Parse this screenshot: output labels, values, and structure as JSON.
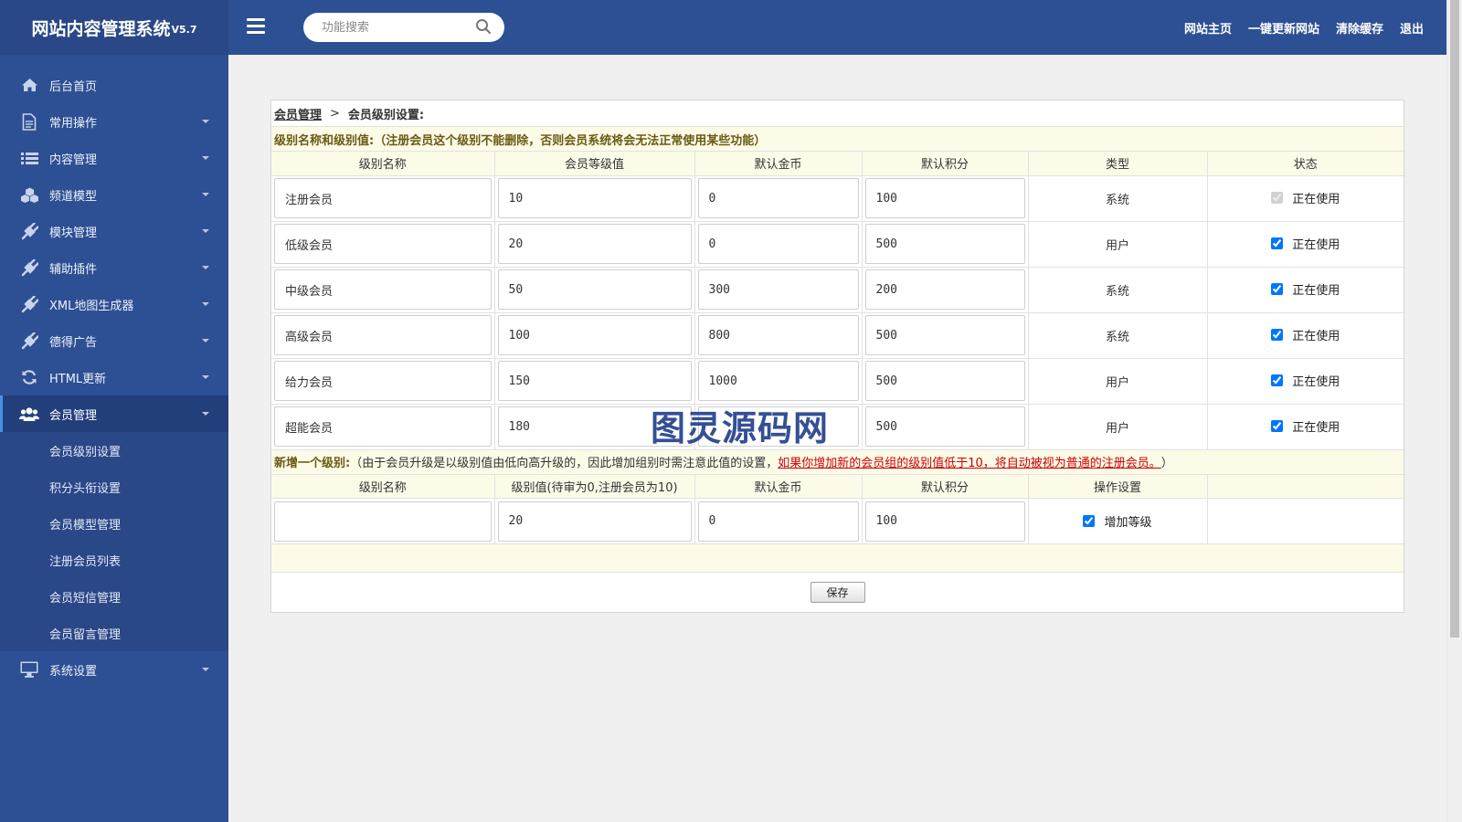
{
  "app": {
    "name": "网站内容管理系统",
    "version": "V5.7"
  },
  "search": {
    "placeholder": "功能搜索",
    "icon": "search-icon"
  },
  "topnav": [
    {
      "label": "网站主页"
    },
    {
      "label": "一键更新网站"
    },
    {
      "label": "清除缓存"
    },
    {
      "label": "退出"
    }
  ],
  "sidebar": {
    "items": [
      {
        "label": "后台首页",
        "icon": "home-icon"
      },
      {
        "label": "常用操作",
        "icon": "document-icon"
      },
      {
        "label": "内容管理",
        "icon": "list-icon"
      },
      {
        "label": "频道模型",
        "icon": "cubes-icon"
      },
      {
        "label": "模块管理",
        "icon": "plug-icon"
      },
      {
        "label": "辅助插件",
        "icon": "plug-icon"
      },
      {
        "label": "XML地图生成器",
        "icon": "plug-icon"
      },
      {
        "label": "德得广告",
        "icon": "plug-icon"
      },
      {
        "label": "HTML更新",
        "icon": "refresh-icon"
      },
      {
        "label": "会员管理",
        "icon": "users-icon"
      },
      {
        "label": "系统设置",
        "icon": "desktop-icon"
      }
    ],
    "submenu": [
      {
        "label": "会员级别设置"
      },
      {
        "label": "积分头衔设置"
      },
      {
        "label": "会员模型管理"
      },
      {
        "label": "注册会员列表"
      },
      {
        "label": "会员短信管理"
      },
      {
        "label": "会员留言管理"
      }
    ]
  },
  "breadcrumb": {
    "parent": "会员管理",
    "separator": ">",
    "current": "会员级别设置:"
  },
  "notice": "级别名称和级别值:（注册会员这个级别不能删除，否则会员系统将会无法正常使用某些功能）",
  "levels_table": {
    "headers": [
      "级别名称",
      "会员等级值",
      "默认金币",
      "默认积分",
      "类型",
      "状态"
    ],
    "rows": [
      {
        "name": "注册会员",
        "level": "10",
        "coins": "0",
        "points": "100",
        "type": "系统",
        "status": "正在使用",
        "checked": true,
        "disabled": true
      },
      {
        "name": "低级会员",
        "level": "20",
        "coins": "0",
        "points": "500",
        "type": "用户",
        "status": "正在使用",
        "checked": true,
        "disabled": false
      },
      {
        "name": "中级会员",
        "level": "50",
        "coins": "300",
        "points": "200",
        "type": "系统",
        "status": "正在使用",
        "checked": true,
        "disabled": false
      },
      {
        "name": "高级会员",
        "level": "100",
        "coins": "800",
        "points": "500",
        "type": "系统",
        "status": "正在使用",
        "checked": true,
        "disabled": false
      },
      {
        "name": "给力会员",
        "level": "150",
        "coins": "1000",
        "points": "500",
        "type": "用户",
        "status": "正在使用",
        "checked": true,
        "disabled": false
      },
      {
        "name": "超能会员",
        "level": "180",
        "coins": "",
        "points": "500",
        "type": "用户",
        "status": "正在使用",
        "checked": true,
        "disabled": false
      }
    ]
  },
  "add_level": {
    "title": "新增一个级别:",
    "hint": "（由于会员升级是以级别值由低向高升级的，因此增加组别时需注意此值的设置，",
    "warning": "如果你增加新的会员组的级别值低于10，将自动被视为普通的注册会员。",
    "hint_end": "）",
    "headers": [
      "级别名称",
      "级别值(待审为0,注册会员为10)",
      "默认金币",
      "默认积分",
      "操作设置",
      ""
    ],
    "row": {
      "name": "",
      "level": "20",
      "coins": "0",
      "points": "100",
      "action": "增加等级",
      "checked": true
    }
  },
  "save_label": "保存",
  "watermark": "图灵源码网",
  "colors": {
    "topbar": "#2d4f93",
    "sidebar": "#2d4f93",
    "submenu": "#2a4887",
    "accent": "#4a90e2",
    "highlight_row": "#fcfbe8",
    "warning": "#cc0000"
  }
}
